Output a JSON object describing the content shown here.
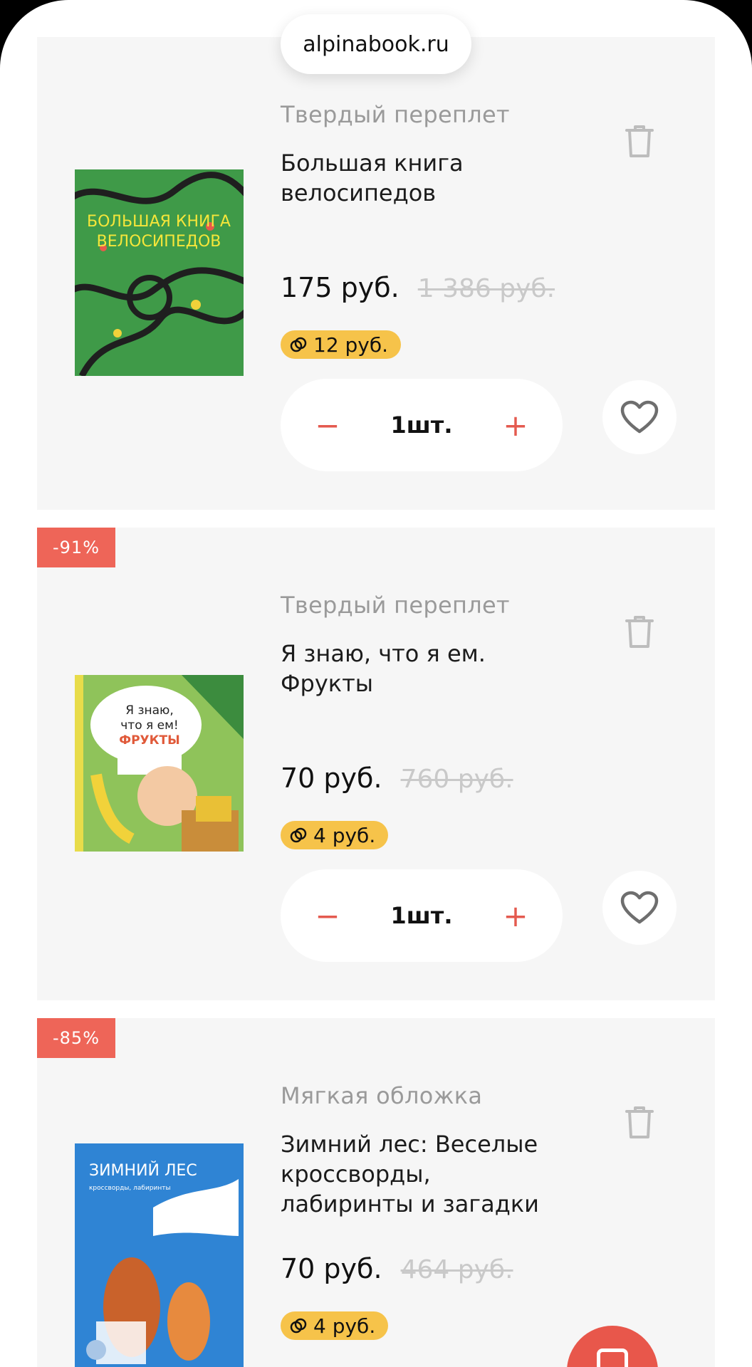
{
  "browser": {
    "url": "alpinabook.ru"
  },
  "cart": {
    "items": [
      {
        "discount_badge": "",
        "binding": "Твердый переплет",
        "title": "Большая книга велосипедов",
        "price": "175 руб.",
        "old_price": "1 386 руб.",
        "bonus": "12 руб.",
        "quantity": "1шт.",
        "cover": {
          "title": "БОЛЬШАЯ КНИГА ВЕЛОСИПЕДОВ",
          "color": "#3f9a48"
        }
      },
      {
        "discount_badge": "-91%",
        "binding": "Твердый переплет",
        "title": "Я знаю, что я ем. Фрукты",
        "price": "70 руб.",
        "old_price": "760 руб.",
        "bonus": "4 руб.",
        "quantity": "1шт.",
        "cover": {
          "title": "Я знаю, что я ем! ФРУКТЫ",
          "color": "#8fc35a"
        }
      },
      {
        "discount_badge": "-85%",
        "binding": "Мягкая обложка",
        "title": "Зимний лес: Веселые кроссворды, лабиринты и загадки",
        "price": "70 руб.",
        "old_price": "464 руб.",
        "bonus": "4 руб.",
        "quantity": "",
        "cover": {
          "title": "ЗИМНИЙ ЛЕС",
          "color": "#2f84d4"
        }
      }
    ]
  },
  "controls": {
    "minus": "−",
    "plus": "+"
  },
  "colors": {
    "accent": "#e8574b",
    "bonus": "#f6c34a",
    "card_bg": "#f6f6f6",
    "discount_badge": "#ee6558"
  },
  "icons": {
    "remove": "trash-icon",
    "favorite": "heart-icon",
    "bonus": "bonus-coin-icon",
    "fab": "phone-icon"
  }
}
